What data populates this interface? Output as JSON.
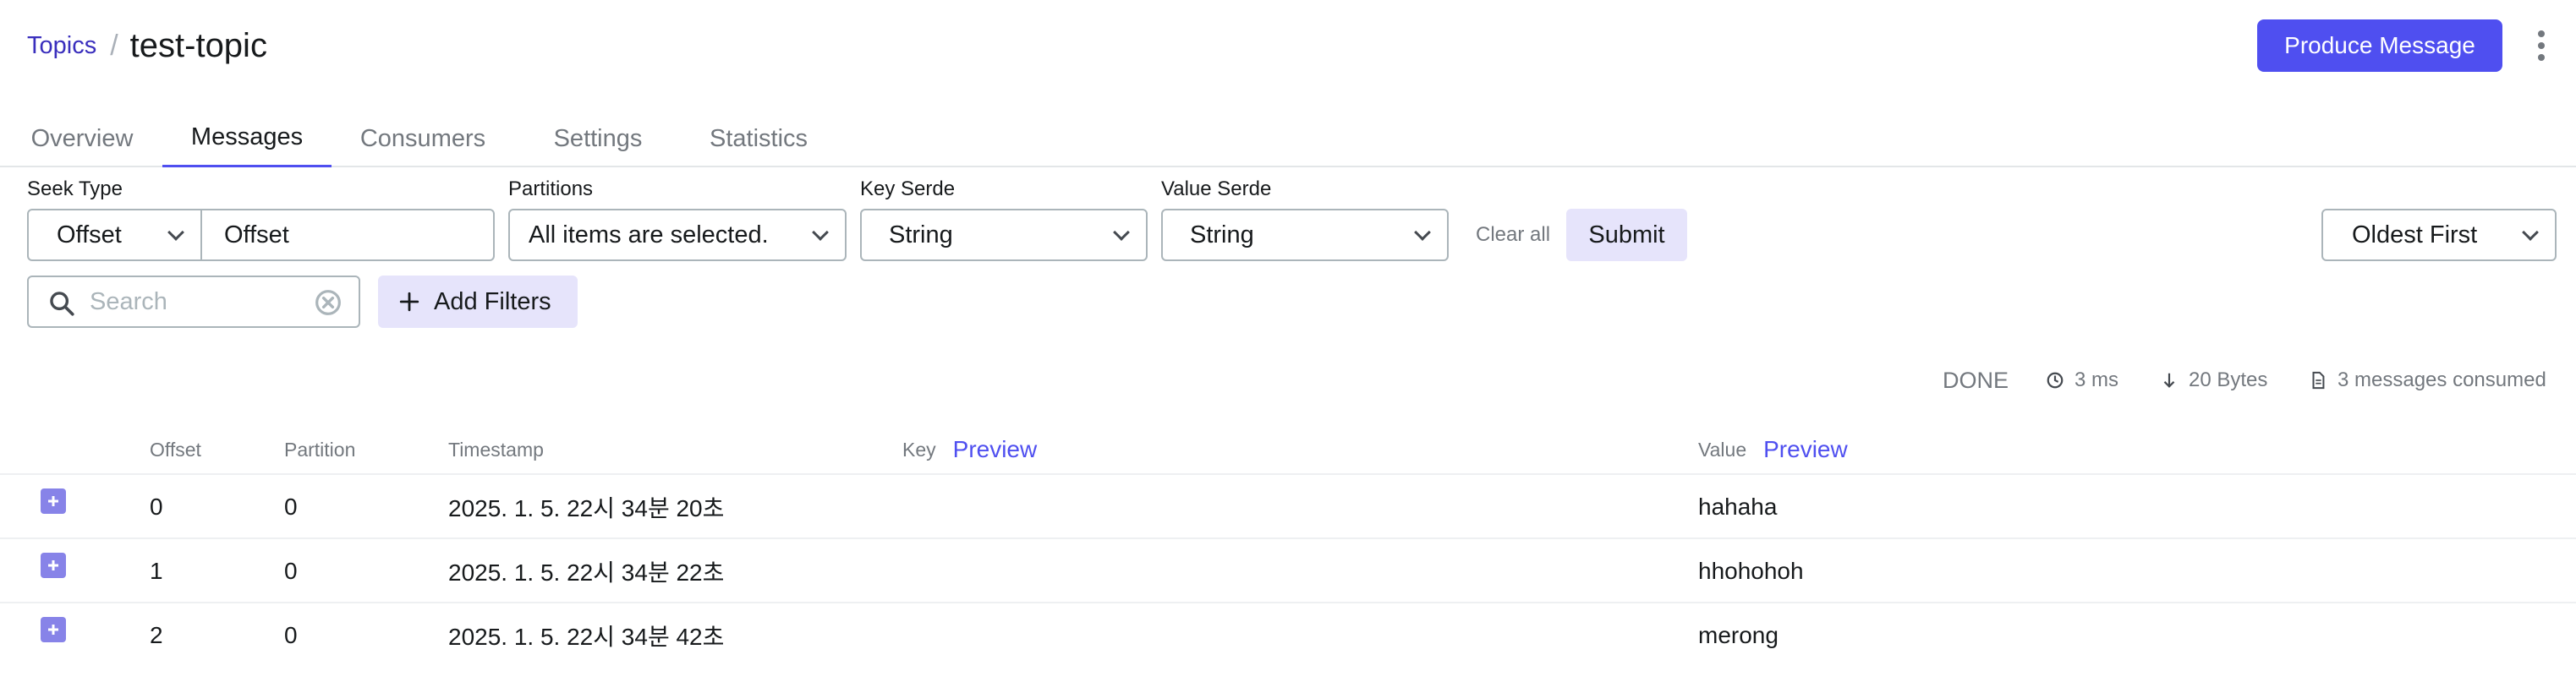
{
  "header": {
    "breadcrumb_link": "Topics",
    "breadcrumb_separator": "/",
    "title": "test-topic",
    "produce_button": "Produce Message",
    "accent_color": "#4f4ff0"
  },
  "tabs": [
    {
      "label": "Overview",
      "active": false
    },
    {
      "label": "Messages",
      "active": true
    },
    {
      "label": "Consumers",
      "active": false
    },
    {
      "label": "Settings",
      "active": false
    },
    {
      "label": "Statistics",
      "active": false
    }
  ],
  "filters": {
    "seek_type_label": "Seek Type",
    "seek_type_value": "Offset",
    "seek_input_value": "Offset",
    "partitions_label": "Partitions",
    "partitions_value": "All items are selected.",
    "key_serde_label": "Key Serde",
    "key_serde_value": "String",
    "value_serde_label": "Value Serde",
    "value_serde_value": "String",
    "clear_all": "Clear all",
    "submit": "Submit",
    "sort_value": "Oldest First",
    "search_placeholder": "Search",
    "add_filters": "Add Filters"
  },
  "status": {
    "state": "DONE",
    "elapsed": "3 ms",
    "bytes": "20 Bytes",
    "consumed": "3 messages consumed"
  },
  "table": {
    "columns": {
      "offset": "Offset",
      "partition": "Partition",
      "timestamp": "Timestamp",
      "key": "Key",
      "value": "Value",
      "preview": "Preview"
    },
    "rows": [
      {
        "offset": "0",
        "partition": "0",
        "timestamp": "2025. 1. 5. 22시 34분 20초",
        "key": "",
        "value": "hahaha"
      },
      {
        "offset": "1",
        "partition": "0",
        "timestamp": "2025. 1. 5. 22시 34분 22초",
        "key": "",
        "value": "hhohohoh"
      },
      {
        "offset": "2",
        "partition": "0",
        "timestamp": "2025. 1. 5. 22시 34분 42초",
        "key": "",
        "value": "merong"
      }
    ]
  }
}
